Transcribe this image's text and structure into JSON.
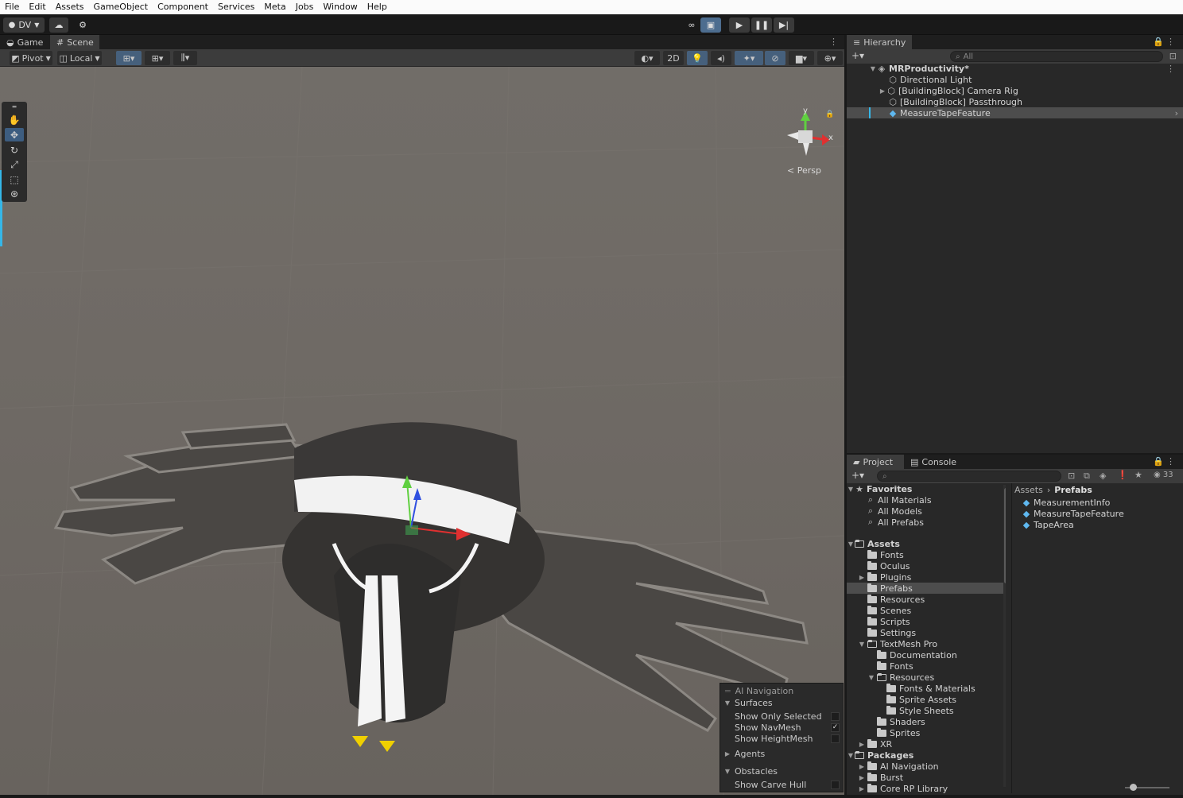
{
  "menu": [
    "File",
    "Edit",
    "Assets",
    "GameObject",
    "Component",
    "Services",
    "Meta",
    "Jobs",
    "Window",
    "Help"
  ],
  "toolbar": {
    "account": "DV"
  },
  "scene": {
    "tabs": [
      "Game",
      "Scene"
    ],
    "pivot": "Pivot",
    "local": "Local",
    "mode_2d": "2D",
    "persp": "< Persp",
    "axis_y": "y",
    "axis_x": "x"
  },
  "ai_nav": {
    "title": "AI Navigation",
    "surfaces": "Surfaces",
    "show_only_selected": "Show Only Selected",
    "show_navmesh": "Show NavMesh",
    "show_heightmesh": "Show HeightMesh",
    "agents": "Agents",
    "obstacles": "Obstacles",
    "show_carve_hull": "Show Carve Hull",
    "navmesh_checked": true
  },
  "hierarchy": {
    "tab": "Hierarchy",
    "search_placeholder": "All",
    "scene_name": "MRProductivity*",
    "items": [
      "Directional Light",
      "[BuildingBlock] Camera Rig",
      "[BuildingBlock] Passthrough",
      "MeasureTapeFeature"
    ]
  },
  "project": {
    "tabs": [
      "Project",
      "Console"
    ],
    "hidden_count": "33",
    "favorites": {
      "label": "Favorites",
      "items": [
        "All Materials",
        "All Models",
        "All Prefabs"
      ]
    },
    "assets_label": "Assets",
    "asset_folders": [
      "Fonts",
      "Oculus",
      "Plugins",
      "Prefabs",
      "Resources",
      "Scenes",
      "Scripts",
      "Settings"
    ],
    "textmesh": {
      "label": "TextMesh Pro",
      "children": [
        "Documentation",
        "Fonts"
      ],
      "resources": "Resources",
      "resources_children": [
        "Fonts & Materials",
        "Sprite Assets",
        "Style Sheets"
      ],
      "more": [
        "Shaders",
        "Sprites"
      ]
    },
    "xr": "XR",
    "packages_label": "Packages",
    "packages": [
      "AI Navigation",
      "Burst",
      "Core RP Library"
    ],
    "breadcrumb": [
      "Assets",
      "Prefabs"
    ],
    "prefabs": [
      "MeasurementInfo",
      "MeasureTapeFeature",
      "TapeArea"
    ]
  }
}
